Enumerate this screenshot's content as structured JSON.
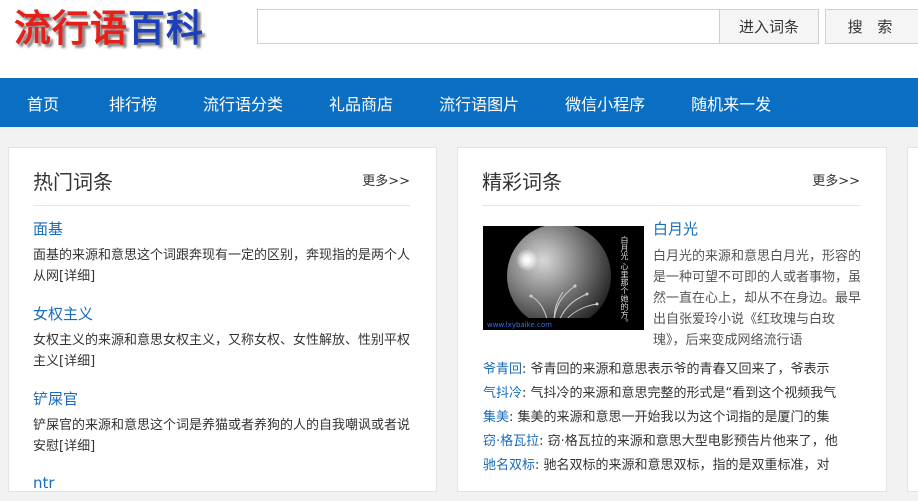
{
  "header": {
    "logo_part1": "流行语",
    "logo_part2": "百科",
    "search_placeholder": "",
    "enter_button": "进入词条",
    "search_button": "搜 索"
  },
  "nav": [
    "首页",
    "排行榜",
    "流行语分类",
    "礼品商店",
    "流行语图片",
    "微信小程序",
    "随机来一发"
  ],
  "hot": {
    "title": "热门词条",
    "more": "更多>>",
    "entries": [
      {
        "title": "面基",
        "desc": "面基的来源和意思这个词跟奔现有一定的区别，奔现指的是两个人从网",
        "detail": "[详细]"
      },
      {
        "title": "女权主义",
        "desc": "女权主义的来源和意思女权主义，又称女权、女性解放、性别平权主义",
        "detail": "[详细]"
      },
      {
        "title": "铲屎官",
        "desc": "铲屎官的来源和意思这个词是养猫或者养狗的人的自我嘲讽或者说安慰",
        "detail": "[详细]"
      },
      {
        "title": "ntr",
        "desc": "",
        "detail": ""
      }
    ]
  },
  "featured": {
    "title": "精彩词条",
    "more": "更多>>",
    "image": {
      "caption": "白月光 心里那个她的方。",
      "watermark": "www.lxybaike.com"
    },
    "main_title": "白月光",
    "main_desc": "白月光的来源和意思白月光，形容的是一种可望不可即的人或者事物，虽然一直在心上，却从不在身边。最早出自张爱玲小说《红玫瑰与白玫瑰》，后来变成网络流行语",
    "list": [
      {
        "key": "爷青回",
        "text": ": 爷青回的来源和意思表示爷的青春又回来了，爷表示"
      },
      {
        "key": "气抖冷",
        "text": ": 气抖冷的来源和意思完整的形式是“看到这个视频我气"
      },
      {
        "key": "集美",
        "text": ": 集美的来源和意思一开始我以为这个词指的是厦门的集"
      },
      {
        "key": "窃·格瓦拉",
        "text": ": 窃·格瓦拉的来源和意思大型电影预告片他来了，他"
      },
      {
        "key": "驰名双标",
        "text": ": 驰名双标的来源和意思双标，指的是双重标准，对"
      }
    ]
  }
}
